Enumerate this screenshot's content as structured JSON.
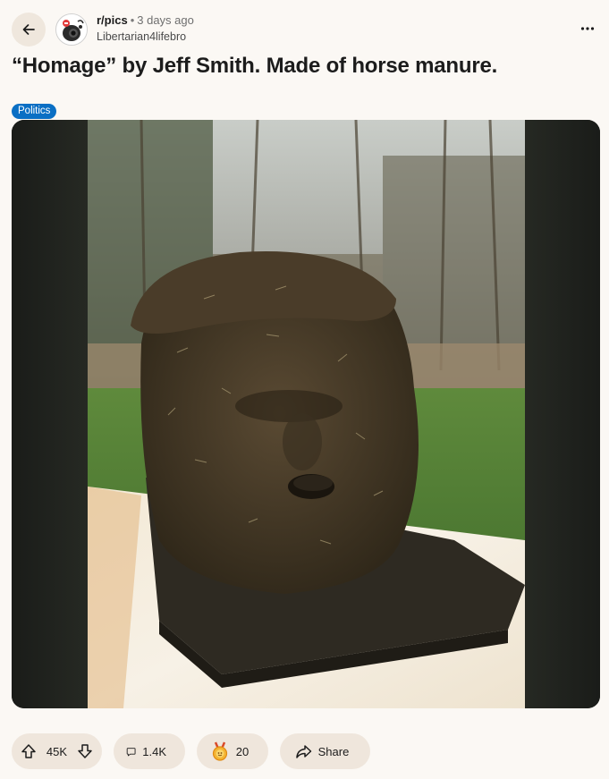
{
  "header": {
    "back_icon": "arrow-left-icon",
    "subreddit": "r/pics",
    "separator": "•",
    "time_ago": "3 days ago",
    "username": "Libertarian4lifebro",
    "more_icon": "ellipsis-horizontal-icon"
  },
  "post": {
    "title": "“Homage” by Jeff Smith. Made of horse manure.",
    "flair": "Politics",
    "flair_color": "#0a6fc4"
  },
  "actions": {
    "upvotes": "45K",
    "comments": "1.4K",
    "awards": "20",
    "share_label": "Share",
    "upvote_icon": "arrow-up-icon",
    "downvote_icon": "arrow-down-icon",
    "comment_icon": "speech-bubble-icon",
    "award_icon": "award-medal-icon",
    "share_icon": "share-arrow-icon"
  },
  "colors": {
    "background": "#fbf8f4",
    "pill": "#efe6dc",
    "text": "#1c1c1c"
  }
}
